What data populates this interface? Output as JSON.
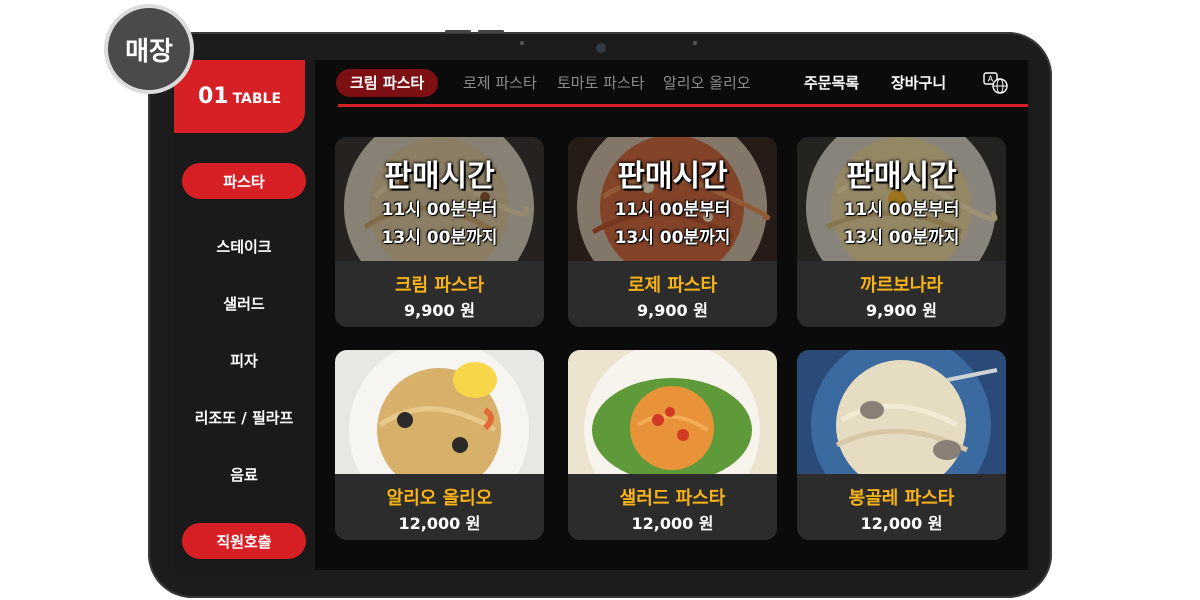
{
  "badge": "매장",
  "table": {
    "number": "01",
    "label": "TABLE"
  },
  "sidebar": {
    "items": [
      {
        "label": "파스타",
        "active": true
      },
      {
        "label": "스테이크"
      },
      {
        "label": "샐러드"
      },
      {
        "label": "피자"
      },
      {
        "label": "리조또 / 필라프"
      },
      {
        "label": "음료"
      }
    ],
    "call_button": "직원호출"
  },
  "tabs": [
    {
      "label": "크림 파스타",
      "active": true
    },
    {
      "label": "로제 파스타"
    },
    {
      "label": "토마토 파스타"
    },
    {
      "label": "알리오 올리오"
    }
  ],
  "top_buttons": {
    "order_list": "주문목록",
    "cart": "장바구니",
    "language_icon": "language-icon"
  },
  "sale_time": {
    "title": "판매시간",
    "from": "11시 00분부터",
    "to": "13시 00분까지"
  },
  "menu_items": [
    {
      "name": "크림 파스타",
      "price": "9,900 원",
      "sale_time_overlay": true
    },
    {
      "name": "로제 파스타",
      "price": "9,900 원",
      "sale_time_overlay": true
    },
    {
      "name": "까르보나라",
      "price": "9,900 원",
      "sale_time_overlay": true
    },
    {
      "name": "알리오 올리오",
      "price": "12,000 원"
    },
    {
      "name": "샐러드 파스타",
      "price": "12,000 원"
    },
    {
      "name": "봉골레 파스타",
      "price": "12,000 원"
    }
  ],
  "colors": {
    "accent": "#d71f26",
    "price_name": "#f8b318",
    "tab_active": "#7d1012"
  }
}
